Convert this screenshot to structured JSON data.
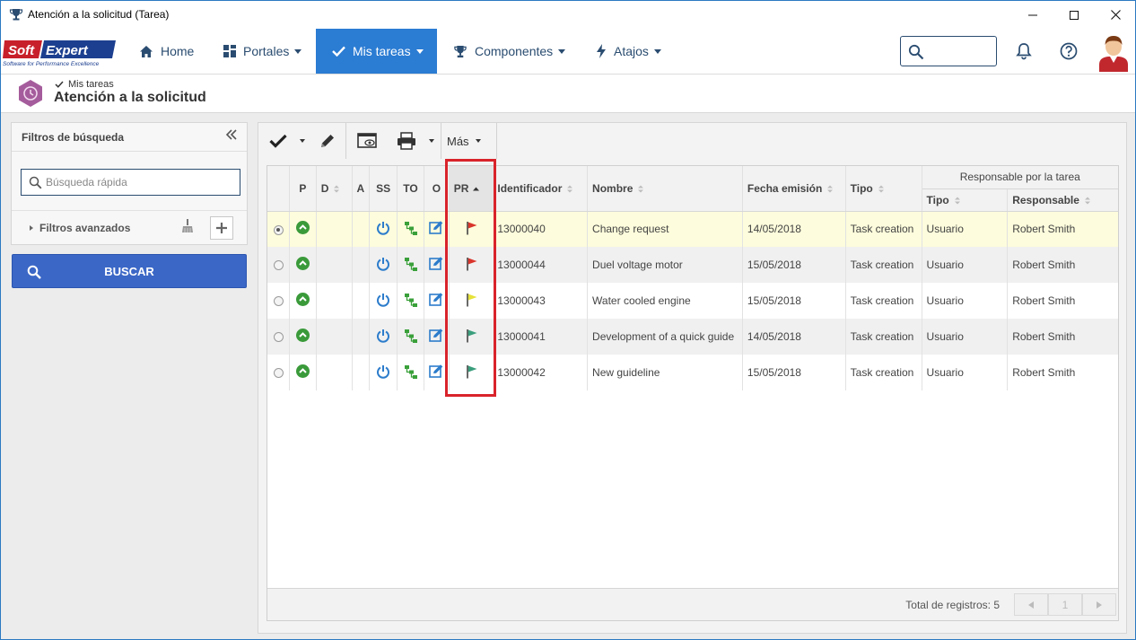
{
  "window": {
    "title": "Atención a la solicitud (Tarea)",
    "minimize": "—",
    "maximize": "☐",
    "close": "✕"
  },
  "logo": {
    "brand": "SoftExpert",
    "tagline": "Software for Performance Excellence"
  },
  "nav": {
    "items": [
      {
        "label": "Home",
        "icon": "home-icon"
      },
      {
        "label": "Portales",
        "icon": "grid-icon"
      },
      {
        "label": "Mis tareas",
        "icon": "check-icon"
      },
      {
        "label": "Componentes",
        "icon": "trophy-icon"
      },
      {
        "label": "Atajos",
        "icon": "bolt-icon"
      }
    ],
    "active": "Mis tareas"
  },
  "header": {
    "breadcrumb": "Mis tareas",
    "title": "Atención a la solicitud"
  },
  "filters": {
    "title": "Filtros de búsqueda",
    "quick_search_placeholder": "Búsqueda rápida",
    "advanced": "Filtros avanzados",
    "search_button": "BUSCAR"
  },
  "toolbar": {
    "more": "Más"
  },
  "grid": {
    "columns": {
      "p": "P",
      "d": "D",
      "a": "A",
      "ss": "SS",
      "to": "TO",
      "o": "O",
      "pr": "PR",
      "identificador": "Identificador",
      "nombre": "Nombre",
      "fecha": "Fecha emisión",
      "tipo": "Tipo",
      "group": "Responsable por la tarea",
      "resp_tipo": "Tipo",
      "responsable": "Responsable"
    },
    "rows": [
      {
        "id": "13000040",
        "name": "Change request",
        "date": "14/05/2018",
        "type": "Task creation",
        "resp_type": "Usuario",
        "responsible": "Robert Smith",
        "priority_color": "#d9342b",
        "selected": true
      },
      {
        "id": "13000044",
        "name": "Duel voltage motor",
        "date": "15/05/2018",
        "type": "Task creation",
        "resp_type": "Usuario",
        "responsible": "Robert Smith",
        "priority_color": "#d9342b",
        "selected": false
      },
      {
        "id": "13000043",
        "name": "Water cooled engine",
        "date": "15/05/2018",
        "type": "Task creation",
        "resp_type": "Usuario",
        "responsible": "Robert Smith",
        "priority_color": "#e6e23a",
        "selected": false
      },
      {
        "id": "13000041",
        "name": "Development of a quick guide",
        "date": "14/05/2018",
        "type": "Task creation",
        "resp_type": "Usuario",
        "responsible": "Robert Smith",
        "priority_color": "#3a9e7c",
        "selected": false
      },
      {
        "id": "13000042",
        "name": "New guideline",
        "date": "15/05/2018",
        "type": "Task creation",
        "resp_type": "Usuario",
        "responsible": "Robert Smith",
        "priority_color": "#3a9e7c",
        "selected": false
      }
    ],
    "total": "Total de registros: 5",
    "page": "1"
  }
}
